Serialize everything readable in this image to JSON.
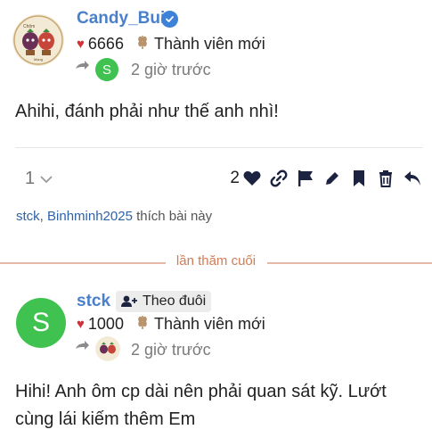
{
  "post1": {
    "username": "Candy_Bui",
    "likes_received": "6666",
    "rank": "Thành viên mới",
    "time": "2 giờ trước",
    "reply_to_avatar_letter": "S",
    "body": "Ahihi, đánh phải như thế anh nhì!",
    "reply_count": "1",
    "like_count": "2",
    "liked_by": [
      "stck",
      "Binhminh2025"
    ],
    "liked_by_suffix": "thích bài này"
  },
  "last_visit_label": "lần thăm cuối",
  "post2": {
    "avatar_letter": "S",
    "username": "stck",
    "follow_label": "Theo đuôi",
    "likes_received": "1000",
    "rank": "Thành viên mới",
    "time": "2 giờ trước",
    "body_line1": "Hihi! Anh ôm cp dài nên phải quan sát kỹ. Lướt",
    "body_line2": "cùng lái kiếm thêm Em"
  },
  "colors": {
    "username": "#4a7fc9",
    "heart": "#d4313a",
    "avatar_green": "#3fc24f",
    "last_visit_accent": "#d07c55"
  }
}
